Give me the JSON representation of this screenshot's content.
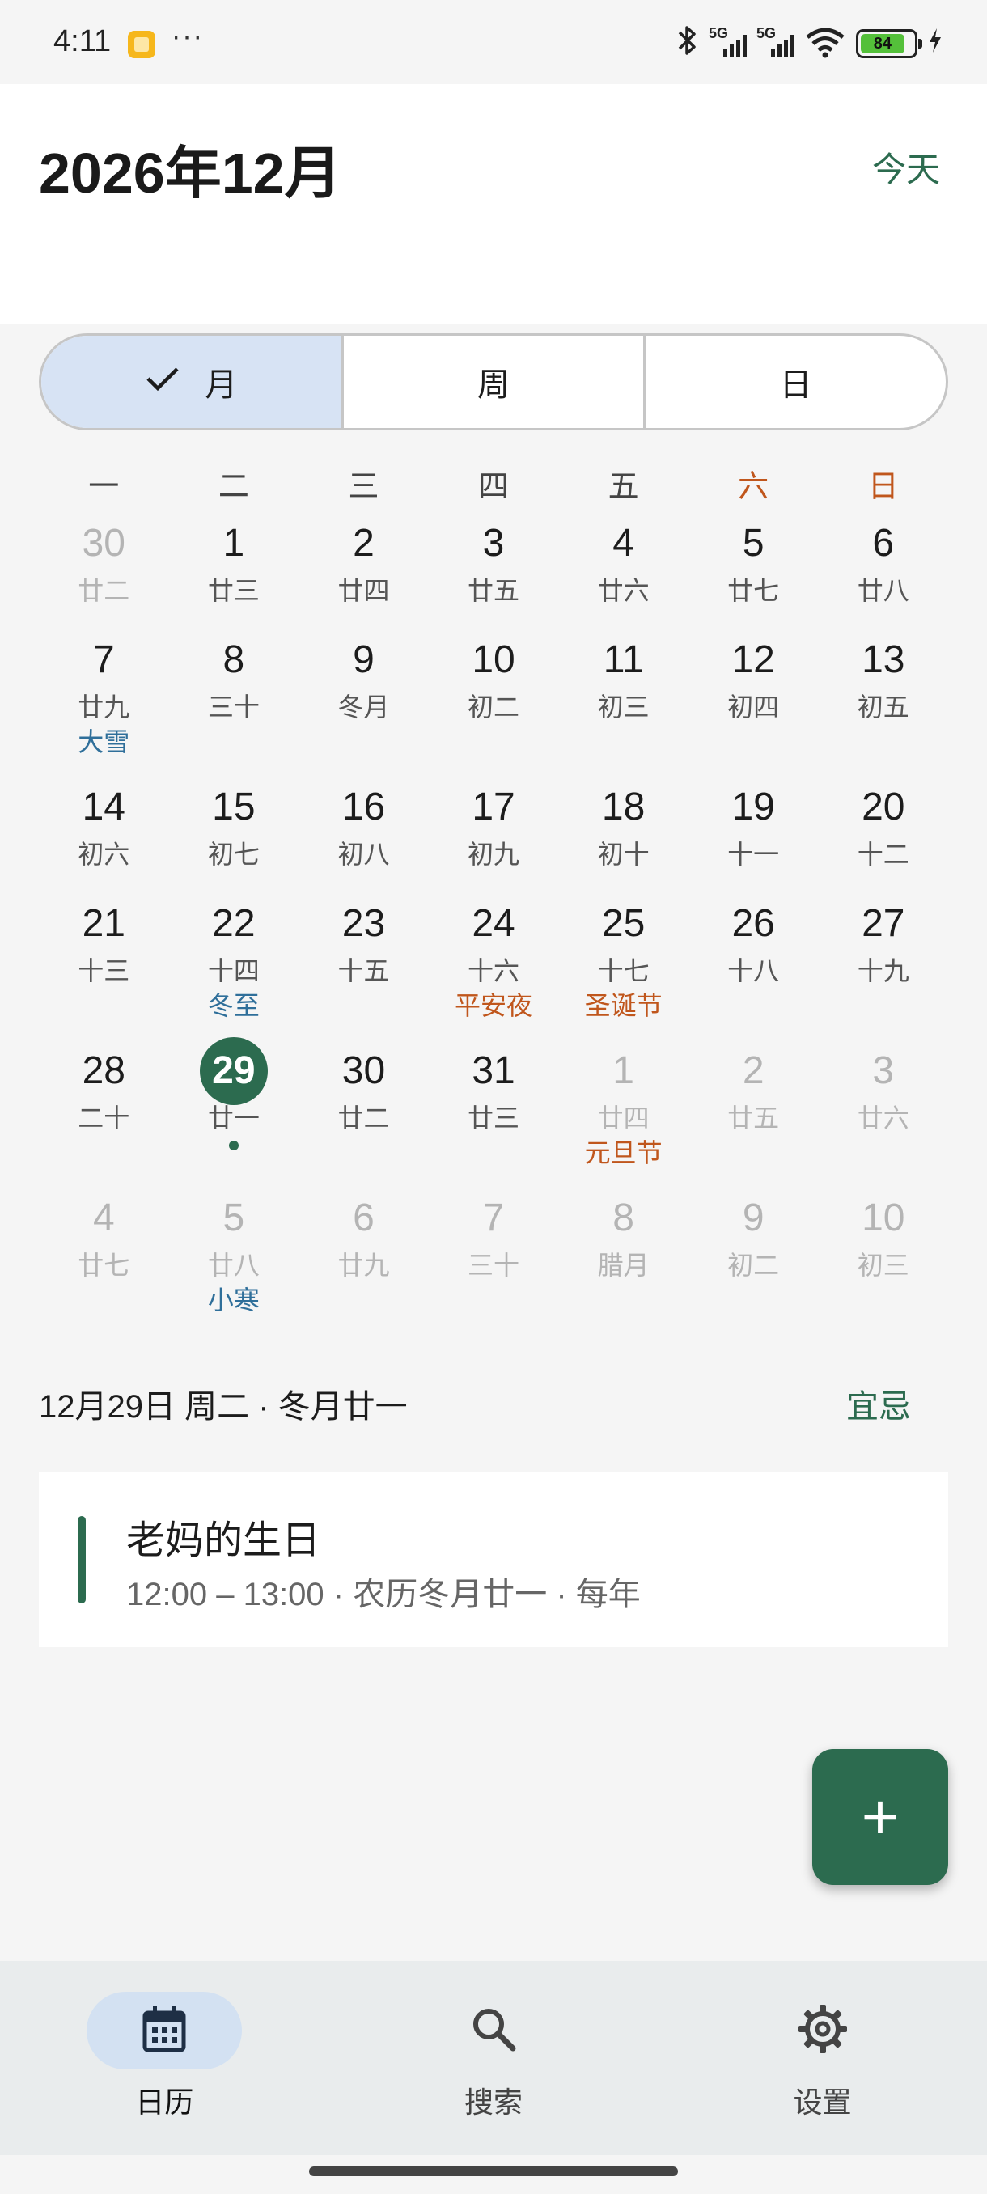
{
  "status_bar": {
    "time": "4:11",
    "more": "···",
    "signal1_label": "5G",
    "signal2_label": "5G",
    "battery": "84",
    "battery_level": 0.84
  },
  "header": {
    "title": "2026年12月",
    "today_label": "今天"
  },
  "view_switch": {
    "options": [
      "月",
      "周",
      "日"
    ],
    "selected": "月"
  },
  "weekdays": [
    "一",
    "二",
    "三",
    "四",
    "五",
    "六",
    "日"
  ],
  "calendar": {
    "weeks": [
      [
        {
          "day": "30",
          "lunar": "廿二",
          "out": true
        },
        {
          "day": "1",
          "lunar": "廿三"
        },
        {
          "day": "2",
          "lunar": "廿四"
        },
        {
          "day": "3",
          "lunar": "廿五"
        },
        {
          "day": "4",
          "lunar": "廿六"
        },
        {
          "day": "5",
          "lunar": "廿七"
        },
        {
          "day": "6",
          "lunar": "廿八"
        }
      ],
      [
        {
          "day": "7",
          "lunar": "廿九",
          "extra": "大雪",
          "extra_type": "term"
        },
        {
          "day": "8",
          "lunar": "三十"
        },
        {
          "day": "9",
          "lunar": "冬月"
        },
        {
          "day": "10",
          "lunar": "初二"
        },
        {
          "day": "11",
          "lunar": "初三"
        },
        {
          "day": "12",
          "lunar": "初四"
        },
        {
          "day": "13",
          "lunar": "初五"
        }
      ],
      [
        {
          "day": "14",
          "lunar": "初六"
        },
        {
          "day": "15",
          "lunar": "初七"
        },
        {
          "day": "16",
          "lunar": "初八"
        },
        {
          "day": "17",
          "lunar": "初九"
        },
        {
          "day": "18",
          "lunar": "初十"
        },
        {
          "day": "19",
          "lunar": "十一"
        },
        {
          "day": "20",
          "lunar": "十二"
        }
      ],
      [
        {
          "day": "21",
          "lunar": "十三"
        },
        {
          "day": "22",
          "lunar": "十四",
          "extra": "冬至",
          "extra_type": "term"
        },
        {
          "day": "23",
          "lunar": "十五"
        },
        {
          "day": "24",
          "lunar": "十六",
          "extra": "平安夜",
          "extra_type": "fest"
        },
        {
          "day": "25",
          "lunar": "十七",
          "extra": "圣诞节",
          "extra_type": "fest"
        },
        {
          "day": "26",
          "lunar": "十八"
        },
        {
          "day": "27",
          "lunar": "十九"
        }
      ],
      [
        {
          "day": "28",
          "lunar": "二十"
        },
        {
          "day": "29",
          "lunar": "廿一",
          "selected": true,
          "has_event": true
        },
        {
          "day": "30",
          "lunar": "廿二"
        },
        {
          "day": "31",
          "lunar": "廿三"
        },
        {
          "day": "1",
          "lunar": "廿四",
          "out": true,
          "extra": "元旦节",
          "extra_type": "fest"
        },
        {
          "day": "2",
          "lunar": "廿五",
          "out": true
        },
        {
          "day": "3",
          "lunar": "廿六",
          "out": true
        }
      ],
      [
        {
          "day": "4",
          "lunar": "廿七",
          "out": true
        },
        {
          "day": "5",
          "lunar": "廿八",
          "out": true,
          "extra": "小寒",
          "extra_type": "term"
        },
        {
          "day": "6",
          "lunar": "廿九",
          "out": true
        },
        {
          "day": "7",
          "lunar": "三十",
          "out": true
        },
        {
          "day": "8",
          "lunar": "腊月",
          "out": true
        },
        {
          "day": "9",
          "lunar": "初二",
          "out": true
        },
        {
          "day": "10",
          "lunar": "初三",
          "out": true
        }
      ]
    ]
  },
  "selected_day": {
    "summary": "12月29日 周二 · 冬月廿一",
    "yiji_label": "宜忌"
  },
  "events": [
    {
      "title": "老妈的生日",
      "meta": "12:00 – 13:00 · 农历冬月廿一 · 每年",
      "color": "#2c6b4f"
    }
  ],
  "fab": {
    "label": "+"
  },
  "bottom_nav": {
    "items": [
      {
        "label": "日历",
        "icon": "calendar-icon",
        "active": true
      },
      {
        "label": "搜索",
        "icon": "search-icon",
        "active": false
      },
      {
        "label": "设置",
        "icon": "gear-icon",
        "active": false
      }
    ]
  },
  "colors": {
    "accent": "#2c6b4f",
    "weekend": "#c0561c",
    "solar_term": "#2f6f9a",
    "festival": "#c0561c",
    "segment_active": "#d7e3f4"
  }
}
